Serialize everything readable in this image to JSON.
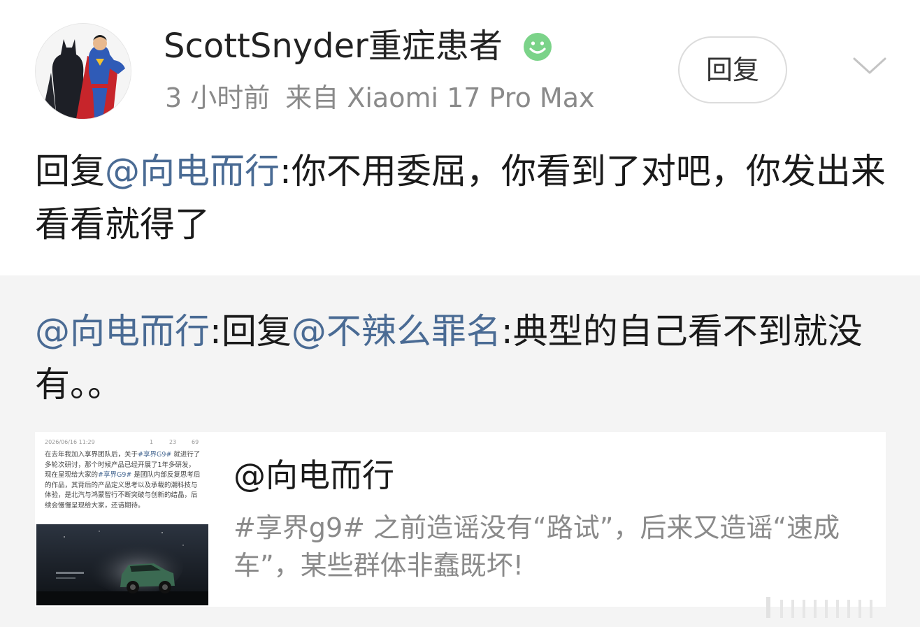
{
  "post": {
    "username": "ScottSnyder重症患者",
    "time": "3 小时前",
    "source": "来自 Xiaomi 17 Pro Max",
    "reply_button": "回复",
    "comment": {
      "prefix": "回复",
      "mention": "@向电而行",
      "body": ":你不用委屈，你看到了对吧，你发出来看看就得了"
    }
  },
  "icons": {
    "vip_badge": "smiley-badge-icon",
    "expand": "chevron-down-icon",
    "avatar": "avatar-batman-superman"
  },
  "quoted": {
    "mention": "@向电而行",
    "reply_prefix": ":回复",
    "reply_mention": "@不辣么罪名",
    "body": ":典型的自己看不到就没有。。"
  },
  "card": {
    "author": "@向电而行",
    "description": "#享界g9# 之前造谣没有“路试”，后来又造谣“速成车”，某些群体非蠢既坏!",
    "thumb": {
      "date": "2026/06/16 11:29",
      "stats": [
        "1",
        "23",
        "69"
      ],
      "text_a": "在去年我加入享界团队后，关于",
      "tag_a": "#享界G9#",
      "text_b": " 就进行了多轮次研讨，那个时候产品已经开展了1年多研发，现在呈现给大家的",
      "tag_b": "#享界G9#",
      "text_c": " 是团队内部反复思考后的作品，其背后的产品定义思考以及承载的潮科技与体验，是北汽与鸿蒙智行不断突破与创新的结晶，后续会慢慢呈现给大家，还请期待。"
    }
  },
  "colors": {
    "mention": "#4a6b94",
    "meta": "#8a8a8a",
    "quote_bg": "#f4f4f4",
    "badge": "#7bd389"
  }
}
